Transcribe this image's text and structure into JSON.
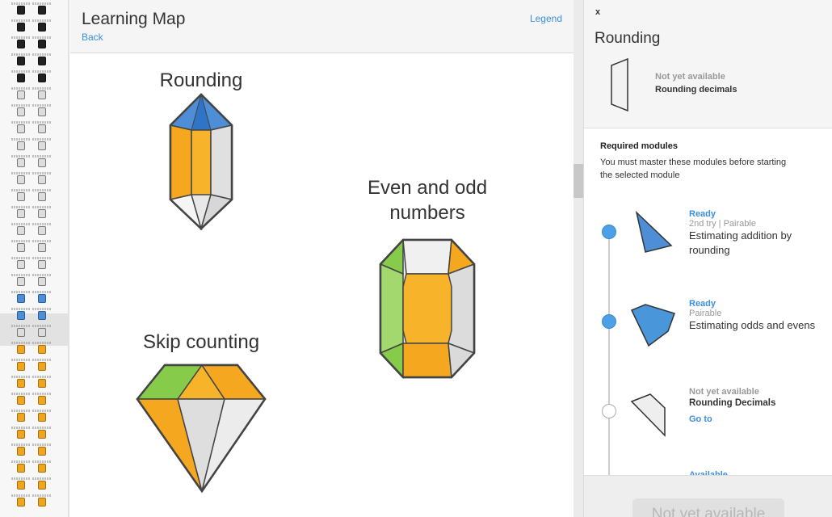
{
  "main": {
    "title": "Learning Map",
    "back_label": "Back",
    "legend_label": "Legend",
    "modules": [
      {
        "label": "Rounding",
        "gem": "blue-orange-hexagonal-crystal",
        "state": "selected"
      },
      {
        "label": "Even and odd numbers",
        "gem": "green-orange-octagonal-emerald"
      },
      {
        "label": "Skip counting",
        "gem": "green-orange-diamond"
      }
    ]
  },
  "panel": {
    "close_label": "x",
    "title": "Rounding",
    "selected_status": "Not yet available",
    "selected_name": "Rounding decimals",
    "required_title": "Required modules",
    "required_desc": "You must master these modules before starting the selected module",
    "required": [
      {
        "status": "Ready",
        "sub": "2nd try | Pairable",
        "name": "Estimating addition by rounding",
        "state": "ready",
        "shape_color": "#4d8ed6"
      },
      {
        "status": "Ready",
        "sub": "Pairable",
        "name": "Estimating odds and evens",
        "state": "ready",
        "shape_color": "#4a96da"
      },
      {
        "status": "Not yet available",
        "name": "Rounding Decimals",
        "goto_label": "Go to",
        "state": "not-available",
        "shape_color": "#eeeeee"
      },
      {
        "status": "Available",
        "state": "available"
      }
    ],
    "footer_button": "Not yet available"
  },
  "colors": {
    "link": "#3b8fdc",
    "gem_blue": "#4d8ed6",
    "gem_orange": "#f5a81f",
    "gem_green": "#86cc4a",
    "gem_grey": "#dcdcdc"
  }
}
